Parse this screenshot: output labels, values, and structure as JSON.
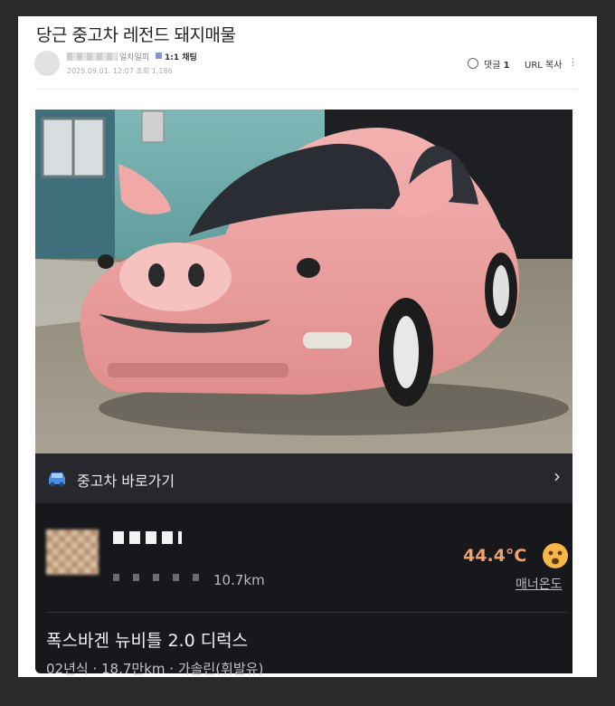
{
  "post": {
    "title": "당근 중고차 레전드 돼지매물",
    "author_tag": "일차일피",
    "chat_label": "1:1 채팅",
    "meta": "2025.09.01. 12:07  조회 1,186",
    "comment_label": "댓글",
    "comment_count": "1",
    "url_copy": "URL 복사",
    "more": "⋮"
  },
  "app": {
    "used_car_label": "중고차 바로가기",
    "chevron": "›",
    "distance": "10.7km",
    "temperature": "44.4°C",
    "manner_temperature": "매너온도",
    "car_name": "폭스바겐 뉴비틀 2.0 디럭스",
    "car_meta": "02년식 · 18.7만km · 가솔린(휘발유)"
  },
  "colors": {
    "background": "#2a2a2a",
    "app_background": "#17181c",
    "used_bar": "#26282e",
    "temperature": "#f2a16a",
    "car_pink": "#f0a6a6"
  },
  "icons": {
    "comment": "comment-icon",
    "car": "car-icon",
    "chevron": "chevron-right-icon",
    "temp_face": "excited-face-icon",
    "more": "more-vertical-icon"
  }
}
